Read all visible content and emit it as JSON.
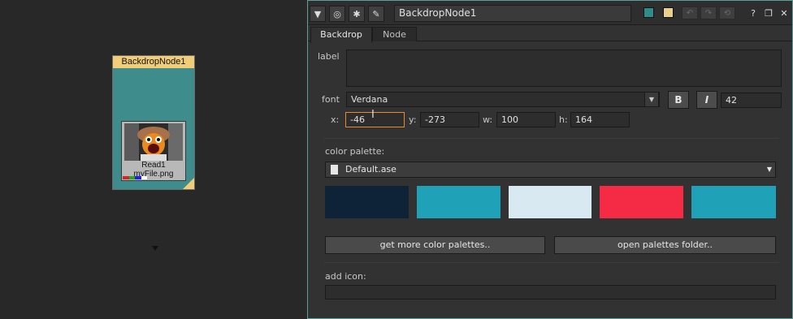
{
  "node_graph": {
    "backdrop_title": "BackdropNode1",
    "backdrop_color": "#3e8d8c",
    "title_color": "#f2cd78",
    "read_node": {
      "label": "Read1",
      "file": "myFile.png",
      "channel_colors": [
        "#d22",
        "#2a2",
        "#22d",
        "#fff"
      ]
    }
  },
  "panel": {
    "header": {
      "node_name": "BackdropNode1",
      "icons": [
        "collapse-icon",
        "viewer-icon",
        "bug-icon",
        "wrench-icon"
      ],
      "swatch_colors": [
        "#2f8c8b",
        "#e8d08a"
      ],
      "help": "?",
      "float_icon": "float-icon",
      "close": "✕"
    },
    "tabs": [
      {
        "label": "Backdrop",
        "active": true
      },
      {
        "label": "Node",
        "active": false
      }
    ],
    "label_field": {
      "label": "label",
      "value": ""
    },
    "font": {
      "label": "font",
      "family": "Verdana",
      "bold_label": "B",
      "italic_label": "I",
      "size": "42"
    },
    "coords": {
      "x_label": "x:",
      "x": "-46",
      "y_label": "y:",
      "y": "-273",
      "w_label": "w:",
      "w": "100",
      "h_label": "h:",
      "h": "164"
    },
    "color_palette": {
      "label": "color palette:",
      "selected": "Default.ase",
      "colors": [
        "#0e2338",
        "#1fa1b8",
        "#d8e9f2",
        "#f52a45",
        "#1fa1b8"
      ]
    },
    "buttons": {
      "get_more": "get more color palettes..",
      "open_folder": "open palettes folder.."
    },
    "add_icon": {
      "label": "add icon:",
      "value": ""
    }
  }
}
